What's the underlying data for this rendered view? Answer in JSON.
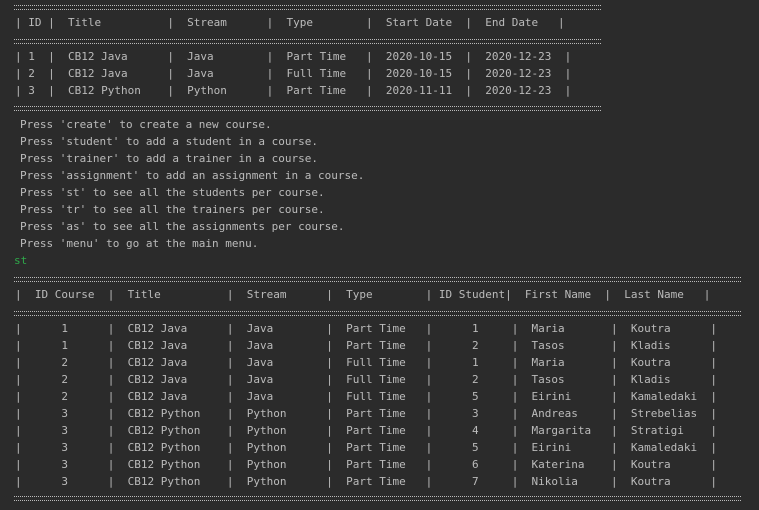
{
  "courses_table": {
    "header": "| ID |  Title          |  Stream      |  Type        |  Start Date  |  End Date   |",
    "rows": [
      "| 1  |  CB12 Java      |  Java        |  Part Time   |  2020-10-15  |  2020-12-23  |",
      "| 2  |  CB12 Java      |  Java        |  Full Time   |  2020-10-15  |  2020-12-23  |",
      "| 3  |  CB12 Python    |  Python      |  Part Time   |  2020-11-11  |  2020-12-23  |"
    ]
  },
  "menu": [
    "Press 'create' to create a new course.",
    "Press 'student' to add a student in a course.",
    "Press 'trainer' to add a trainer in a course.",
    "Press 'assignment' to add an assignment in a course.",
    "Press 'st' to see all the students per course.",
    "Press 'tr' to see all the trainers per course.",
    "Press 'as' to see all the assignments per course.",
    "Press 'menu' to go at the main menu."
  ],
  "typed_command": "st",
  "students_table": {
    "header": "|  ID Course  |  Title          |  Stream      |  Type        | ID Student|  First Name  |  Last Name   |",
    "rows": [
      "|      1      |  CB12 Java      |  Java        |  Part Time   |      1     |  Maria       |  Koutra      |",
      "|      1      |  CB12 Java      |  Java        |  Part Time   |      2     |  Tasos       |  Kladis      |",
      "|      2      |  CB12 Java      |  Java        |  Full Time   |      1     |  Maria       |  Koutra      |",
      "|      2      |  CB12 Java      |  Java        |  Full Time   |      2     |  Tasos       |  Kladis      |",
      "|      2      |  CB12 Java      |  Java        |  Full Time   |      5     |  Eirini      |  Kamaledaki  |",
      "|      3      |  CB12 Python    |  Python      |  Part Time   |      3     |  Andreas     |  Strebelias  |",
      "|      3      |  CB12 Python    |  Python      |  Part Time   |      4     |  Margarita   |  Stratigi    |",
      "|      3      |  CB12 Python    |  Python      |  Part Time   |      5     |  Eirini      |  Kamaledaki  |",
      "|      3      |  CB12 Python    |  Python      |  Part Time   |      6     |  Katerina    |  Koutra      |",
      "|      3      |  CB12 Python    |  Python      |  Part Time   |      7     |  Nikolia     |  Koutra      |"
    ]
  },
  "colors": {
    "background": "#2b2b2b",
    "text": "#bbbbbb",
    "user_input": "#2fa94a"
  }
}
